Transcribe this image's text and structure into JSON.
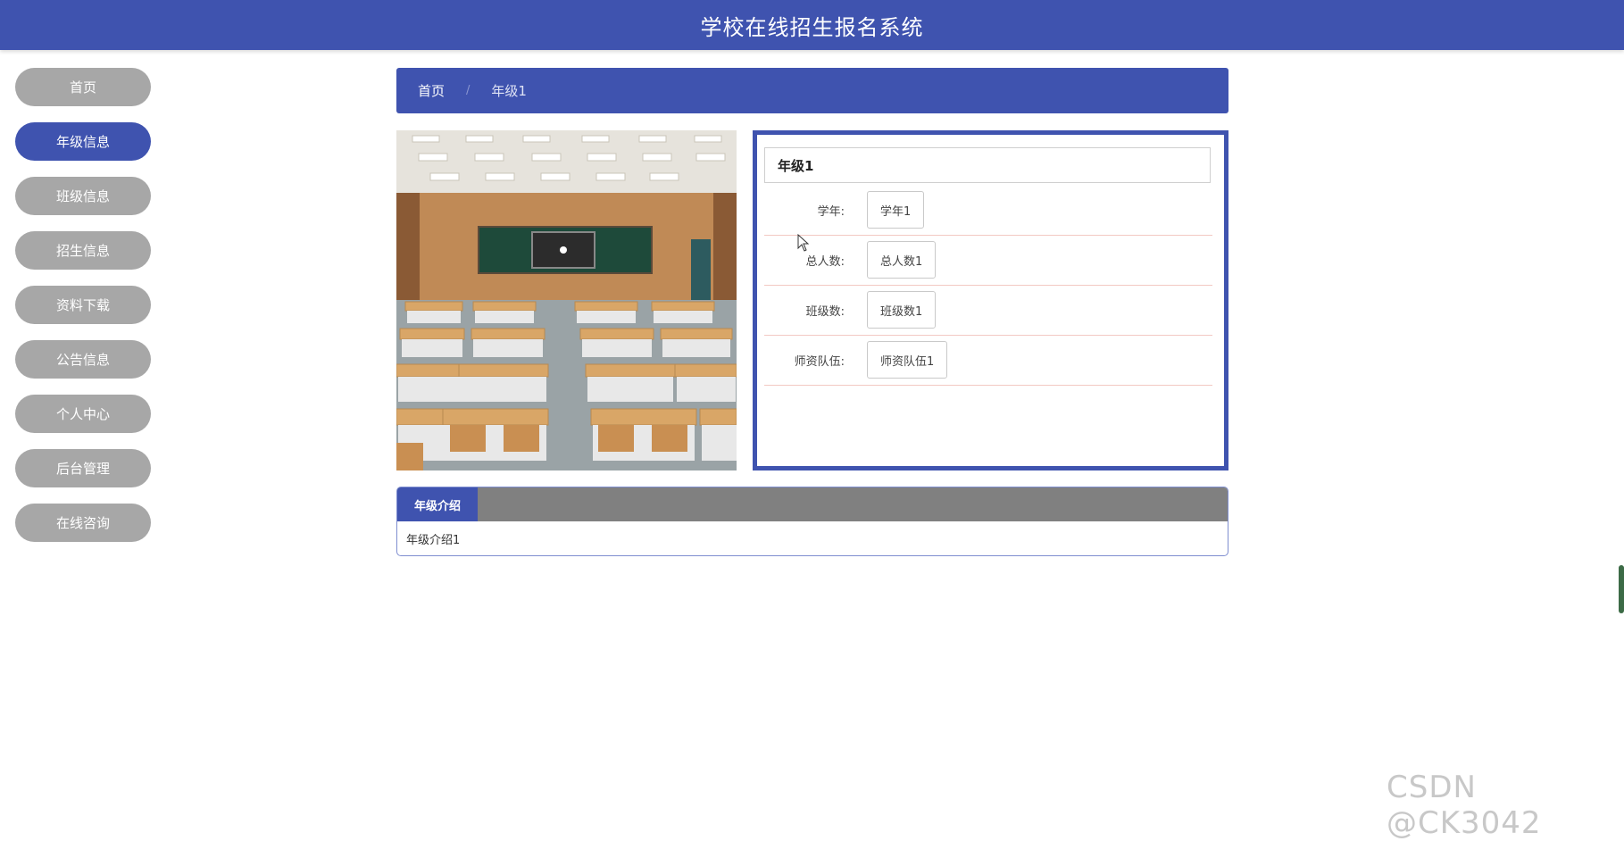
{
  "header": {
    "title": "学校在线招生报名系统"
  },
  "sidebar": {
    "items": [
      {
        "label": "首页"
      },
      {
        "label": "年级信息"
      },
      {
        "label": "班级信息"
      },
      {
        "label": "招生信息"
      },
      {
        "label": "资料下载"
      },
      {
        "label": "公告信息"
      },
      {
        "label": "个人中心"
      },
      {
        "label": "后台管理"
      },
      {
        "label": "在线咨询"
      }
    ],
    "active_index": 1
  },
  "breadcrumb": {
    "home": "首页",
    "separator": "/",
    "current": "年级1"
  },
  "detail": {
    "title": "年级1",
    "fields": [
      {
        "label": "学年:",
        "value": "学年1"
      },
      {
        "label": "总人数:",
        "value": "总人数1"
      },
      {
        "label": "班级数:",
        "value": "班级数1"
      },
      {
        "label": "师资队伍:",
        "value": "师资队伍1"
      }
    ]
  },
  "intro": {
    "tab_label": "年级介绍",
    "content": "年级介绍1"
  },
  "watermark": "CSDN @CK3042",
  "colors": {
    "primary": "#3f53af",
    "nav_inactive": "#a7a7a7",
    "tab_bar": "#808080"
  }
}
